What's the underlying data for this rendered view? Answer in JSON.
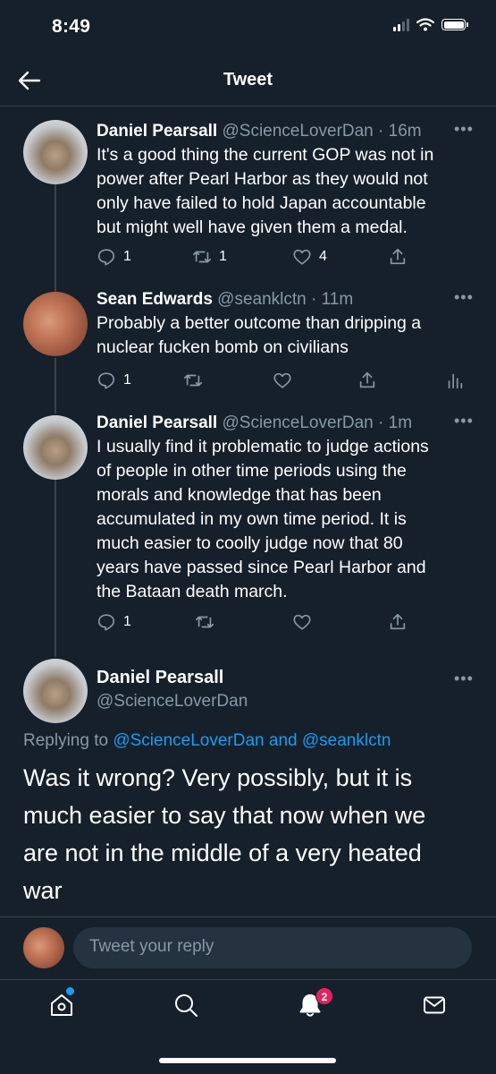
{
  "status_bar": {
    "time": "8:49"
  },
  "header": {
    "title": "Tweet"
  },
  "thread": [
    {
      "name": "Daniel Pearsall",
      "handle": "@ScienceLoverDan",
      "time": "· 16m",
      "lines": [
        "It's a good thing the current GOP was not in",
        "power after Pearl Harbor as they would not",
        "only have failed to hold Japan accountable",
        "but might well have given them a medal."
      ],
      "replies": "1",
      "retweets": "1",
      "likes": "4"
    },
    {
      "name": "Sean Edwards",
      "handle": "@seanklctn",
      "time": "· 11m",
      "lines": [
        "Probably a better outcome than dripping a",
        "nuclear fucken bomb on civilians"
      ],
      "replies": "1",
      "retweets": "",
      "likes": ""
    },
    {
      "name": "Daniel Pearsall",
      "handle": "@ScienceLoverDan",
      "time": "· 1m",
      "lines": [
        "I usually find it problematic to judge actions",
        "of people in other time periods using the",
        "morals and knowledge that has been",
        "accumulated in my own time period. It is",
        "much easier to coolly judge now that 80",
        "years have passed since Pearl Harbor and",
        "the Bataan death march."
      ],
      "replies": "1",
      "retweets": "",
      "likes": ""
    }
  ],
  "main_tweet": {
    "name": "Daniel Pearsall",
    "handle": "@ScienceLoverDan",
    "replying_prefix": "Replying to",
    "replying_user1": "@ScienceLoverDan",
    "replying_and": "and",
    "replying_user2": "@seanklctn",
    "lines": [
      "Was it wrong? Very possibly, but it is",
      "much easier to say that now when we",
      "are not in the middle of a very heated",
      "war"
    ]
  },
  "reply_box": {
    "placeholder": "Tweet your reply"
  },
  "tab_bar": {
    "notification_count": "2"
  },
  "colors": {
    "background": "#15202b",
    "accent": "#1d9bf0",
    "muted": "#8899a6",
    "badge": "#e0245e"
  },
  "icons": [
    "back-arrow-icon",
    "reply-icon",
    "retweet-icon",
    "like-icon",
    "share-icon",
    "analytics-icon",
    "home-icon",
    "search-icon",
    "bell-icon",
    "mail-icon",
    "more-icon"
  ]
}
